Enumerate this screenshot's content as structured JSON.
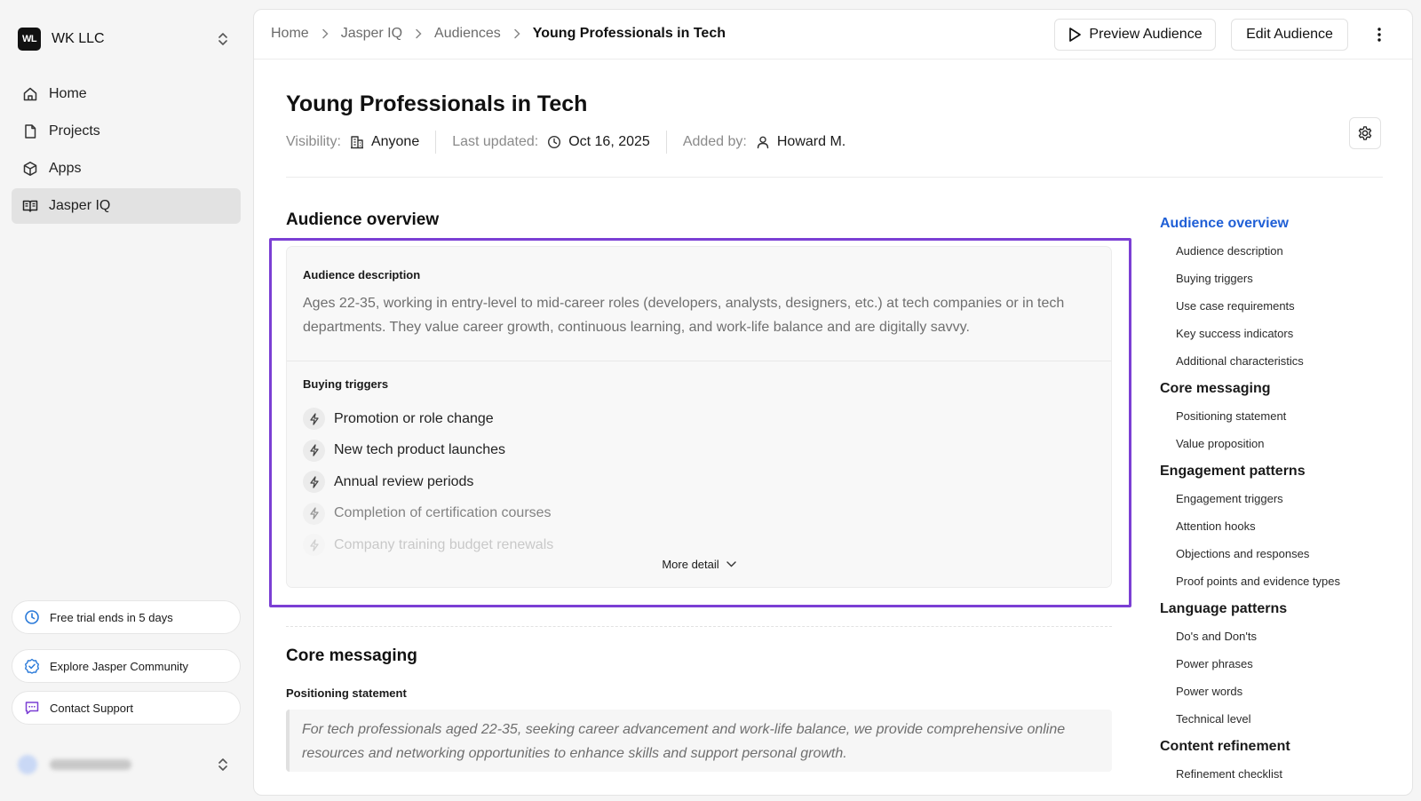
{
  "workspace": {
    "logo": "WL",
    "name": "WK LLC"
  },
  "sidebar": {
    "nav": [
      {
        "label": "Home",
        "icon": "home-icon"
      },
      {
        "label": "Projects",
        "icon": "file-icon"
      },
      {
        "label": "Apps",
        "icon": "cube-icon"
      },
      {
        "label": "Jasper IQ",
        "icon": "book-icon",
        "active": true
      }
    ],
    "trial": "Free trial ends in 5 days",
    "community": "Explore Jasper Community",
    "support": "Contact Support"
  },
  "breadcrumb": [
    "Home",
    "Jasper IQ",
    "Audiences",
    "Young Professionals in Tech"
  ],
  "actions": {
    "preview": "Preview Audience",
    "edit": "Edit Audience"
  },
  "page": {
    "title": "Young Professionals in Tech",
    "meta": {
      "visibility_label": "Visibility:",
      "visibility_value": "Anyone",
      "updated_label": "Last updated:",
      "updated_value": "Oct 16, 2025",
      "added_label": "Added by:",
      "added_value": "Howard M."
    }
  },
  "overview": {
    "heading": "Audience overview",
    "description_label": "Audience description",
    "description": "Ages 22-35, working in entry-level to mid-career roles (developers, analysts, designers, etc.) at tech companies or in tech departments. They value career growth, continuous learning, and work-life balance and are digitally savvy.",
    "triggers_label": "Buying triggers",
    "triggers": [
      "Promotion or role change",
      "New tech product launches",
      "Annual review periods",
      "Completion of certification courses",
      "Company training budget renewals"
    ],
    "more_detail": "More detail"
  },
  "core": {
    "heading": "Core messaging",
    "positioning_label": "Positioning statement",
    "positioning": "For tech professionals aged 22-35, seeking career advancement and work-life balance, we provide comprehensive online resources and networking opportunities to enhance skills and support personal growth."
  },
  "toc": [
    {
      "title": "Audience overview",
      "active": true,
      "items": [
        "Audience description",
        "Buying triggers",
        "Use case requirements",
        "Key success indicators",
        "Additional characteristics"
      ]
    },
    {
      "title": "Core messaging",
      "items": [
        "Positioning statement",
        "Value proposition"
      ]
    },
    {
      "title": "Engagement patterns",
      "items": [
        "Engagement triggers",
        "Attention hooks",
        "Objections and responses",
        "Proof points and evidence types"
      ]
    },
    {
      "title": "Language patterns",
      "items": [
        "Do's and Don'ts",
        "Power phrases",
        "Power words",
        "Technical level"
      ]
    },
    {
      "title": "Content refinement",
      "items": [
        "Refinement checklist"
      ]
    }
  ],
  "colors": {
    "accent": "#1f5fd6",
    "highlight": "#7b3fd4",
    "trial_icon": "#2a7ad9",
    "community_icon": "#2a7ad9",
    "support_icon": "#7b3fd4"
  }
}
